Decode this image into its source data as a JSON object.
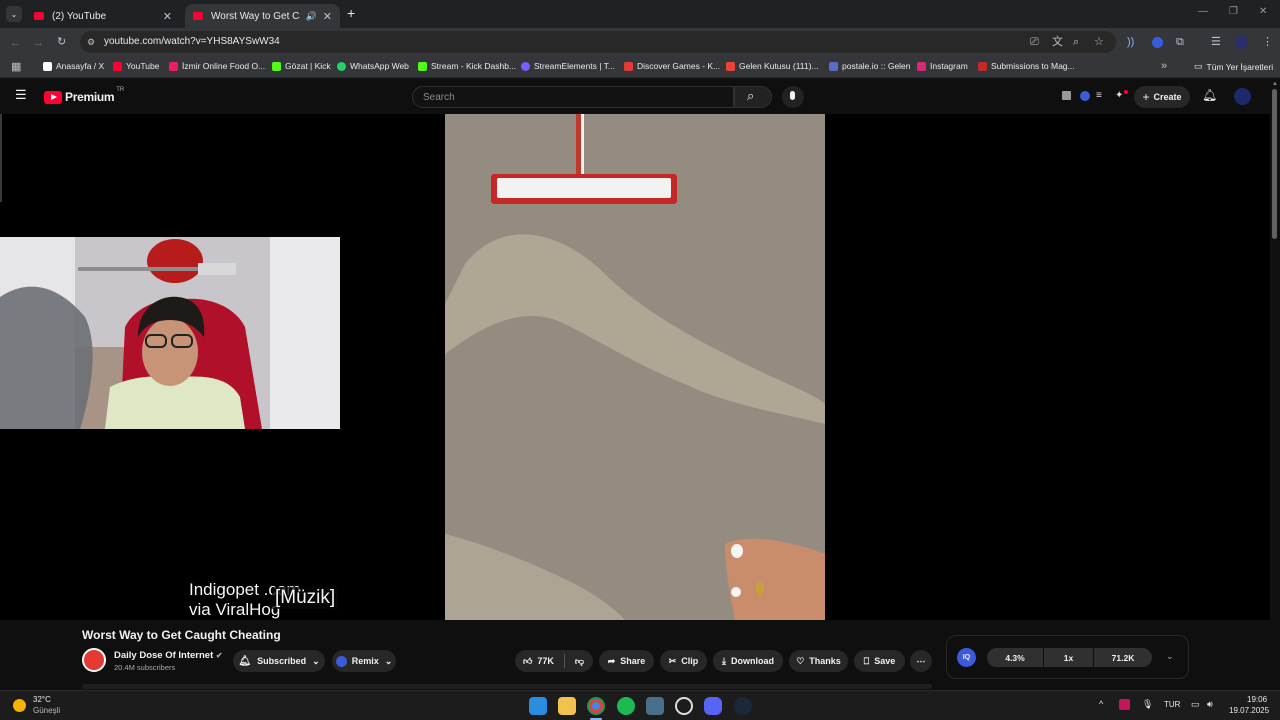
{
  "browser": {
    "tabs": [
      {
        "label": "(2) YouTube"
      },
      {
        "label": "Worst Way to Get Caught Cheating"
      }
    ],
    "url": "youtube.com/watch?v=YHS8AYSwW34",
    "bookmarks": [
      {
        "label": "Anasayfa / X",
        "color": "#000000"
      },
      {
        "label": "YouTube",
        "color": "#ff0033"
      },
      {
        "label": "İzmir Online Food O...",
        "color": "#e91e63"
      },
      {
        "label": "Gözat | Kick",
        "color": "#53fc18"
      },
      {
        "label": "WhatsApp Web",
        "color": "#25d366"
      },
      {
        "label": "Stream - Kick Dashb...",
        "color": "#53fc18"
      },
      {
        "label": "StreamElements | T...",
        "color": "#7b5cff"
      },
      {
        "label": "Discover Games - K...",
        "color": "#e53935"
      },
      {
        "label": "Gelen Kutusu (111)...",
        "color": "#ea4335"
      },
      {
        "label": "postale.io :: Gelen",
        "color": "#5c6bc0"
      },
      {
        "label": "Instagram",
        "color": "#d62976"
      },
      {
        "label": "Submissions to Mag...",
        "color": "#c62828"
      }
    ],
    "all_bookmarks": "Tüm Yer İşaretleri"
  },
  "youtube": {
    "logo_text": "Premium",
    "country_code": "TR",
    "search_placeholder": "Search",
    "create_label": "Create"
  },
  "video": {
    "captions": {
      "watermark_line1": "Indigopet .com",
      "watermark_line2": "via ViralHog",
      "music": "[Müzik]"
    },
    "title": "Worst Way to Get Caught Cheating",
    "channel": "Daily Dose Of Internet",
    "subscribers": "20.4M subscribers",
    "subscribed_label": "Subscribed",
    "remix_label": "Remix",
    "likes": "77K",
    "share_label": "Share",
    "clip_label": "Clip",
    "download_label": "Download",
    "thanks_label": "Thanks",
    "save_label": "Save"
  },
  "extension": {
    "badge": "IQ",
    "values": [
      "4.3%",
      "1x",
      "71.2K"
    ]
  },
  "taskbar": {
    "weather_temp": "32°C",
    "weather_desc": "Güneşli",
    "lang": "TUR",
    "time": "19:06",
    "date": "19.07.2025"
  }
}
